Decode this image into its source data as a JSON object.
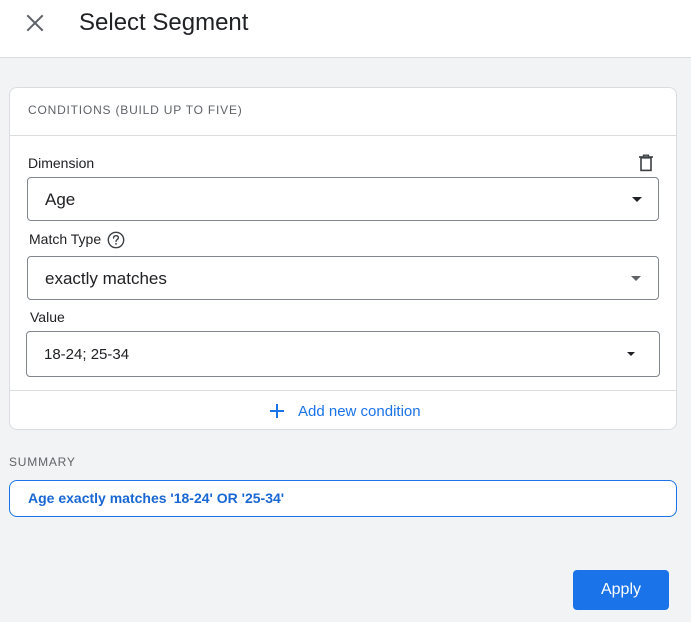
{
  "header": {
    "title": "Select Segment",
    "close_icon": "close-icon"
  },
  "conditions": {
    "heading": "CONDITIONS (BUILD UP TO FIVE)",
    "dimension": {
      "label": "Dimension",
      "value": "Age"
    },
    "match_type": {
      "label": "Match Type",
      "value": "exactly matches"
    },
    "value_field": {
      "label": "Value",
      "value": "18-24; 25-34"
    },
    "add_condition_label": "Add new condition",
    "delete_icon": "trash-icon",
    "help_icon": "help-icon"
  },
  "summary": {
    "label": "SUMMARY",
    "text": "Age exactly matches '18-24' OR '25-34'"
  },
  "footer": {
    "apply_label": "Apply"
  },
  "colors": {
    "accent": "#1a73e8",
    "background": "#f1f3f4",
    "border": "#dadce0"
  }
}
